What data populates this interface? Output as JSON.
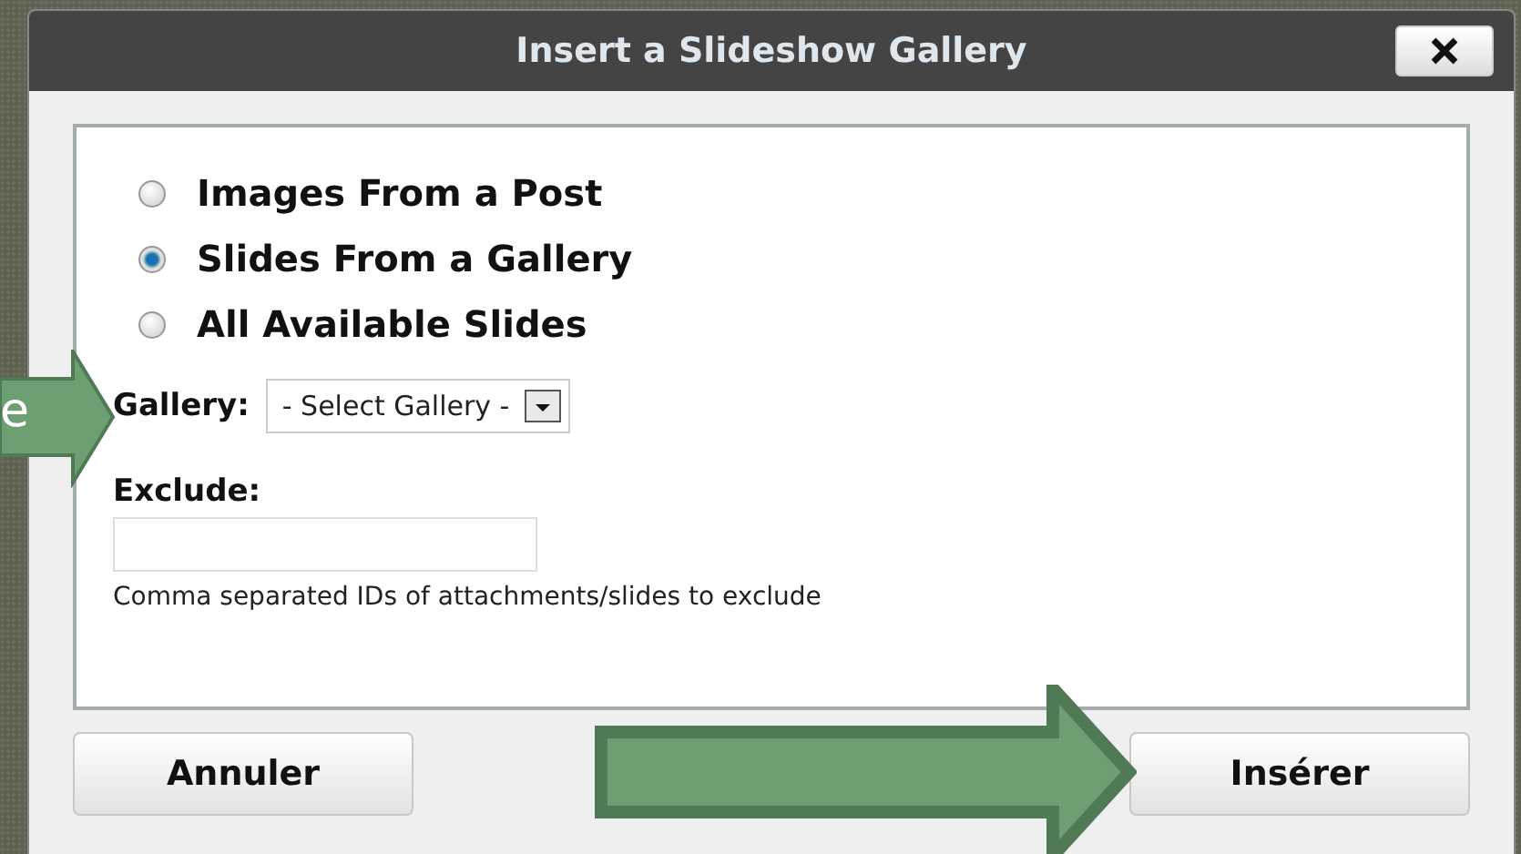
{
  "callout": {
    "text": "e"
  },
  "window": {
    "title": "Insert a Slideshow Gallery"
  },
  "sources": [
    {
      "label": "Images From a Post",
      "selected": false
    },
    {
      "label": "Slides From a Gallery",
      "selected": true
    },
    {
      "label": "All Available Slides",
      "selected": false
    }
  ],
  "gallery": {
    "label": "Gallery:",
    "value": "- Select Gallery -"
  },
  "exclude": {
    "label": "Exclude:",
    "help_text": "Comma separated IDs of attachments/slides to exclude"
  },
  "buttons": [
    "Annuler",
    "Insérer"
  ]
}
